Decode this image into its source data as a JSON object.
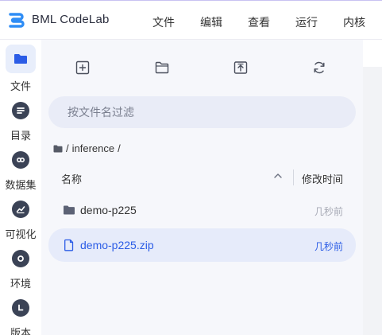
{
  "header": {
    "brand": "BML CodeLab",
    "menu": [
      "文件",
      "编辑",
      "查看",
      "运行",
      "内核"
    ]
  },
  "sidebar": {
    "items": [
      {
        "label": "文件",
        "icon": "folder-icon",
        "active": true
      },
      {
        "label": "目录",
        "icon": "list-icon",
        "active": false
      },
      {
        "label": "数据集",
        "icon": "link-icon",
        "active": false
      },
      {
        "label": "可视化",
        "icon": "chart-icon",
        "active": false
      },
      {
        "label": "环境",
        "icon": "circle-icon",
        "active": false
      },
      {
        "label": "版本",
        "icon": "clock-icon",
        "active": false
      }
    ]
  },
  "toolbar": {
    "buttons": [
      "new-file-icon",
      "new-folder-icon",
      "upload-icon",
      "refresh-icon"
    ]
  },
  "search": {
    "placeholder": "按文件名过滤",
    "value": ""
  },
  "breadcrumb": {
    "separator": "/",
    "path": "inference",
    "trailing": "/"
  },
  "file_list": {
    "columns": {
      "name": "名称",
      "modified": "修改时间"
    },
    "rows": [
      {
        "name": "demo-p225",
        "type": "folder",
        "modified": "几秒前",
        "selected": false
      },
      {
        "name": "demo-p225.zip",
        "type": "file",
        "modified": "几秒前",
        "selected": true
      }
    ]
  },
  "colors": {
    "accent": "#2b5ce6",
    "rail_icon": "#3b4356",
    "active_bg": "#e8eefb",
    "panel_bg": "#f6f7fb",
    "search_bg": "#e9ecf7",
    "selected_row_bg": "#e6ebfa",
    "logo_blue": "#2f8df5"
  }
}
